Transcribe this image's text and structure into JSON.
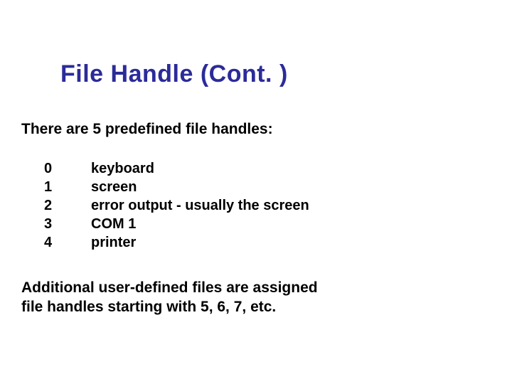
{
  "title": "File Handle (Cont. )",
  "intro": "There are 5 predefined file handles:",
  "handles": [
    {
      "num": "0",
      "desc": "keyboard"
    },
    {
      "num": "1",
      "desc": "screen"
    },
    {
      "num": "2",
      "desc": "error output - usually the screen"
    },
    {
      "num": "3",
      "desc": "COM 1"
    },
    {
      "num": "4",
      "desc": "printer"
    }
  ],
  "footer_line1": "Additional user-defined files are assigned",
  "footer_line2": "file handles starting with 5, 6, 7, etc."
}
